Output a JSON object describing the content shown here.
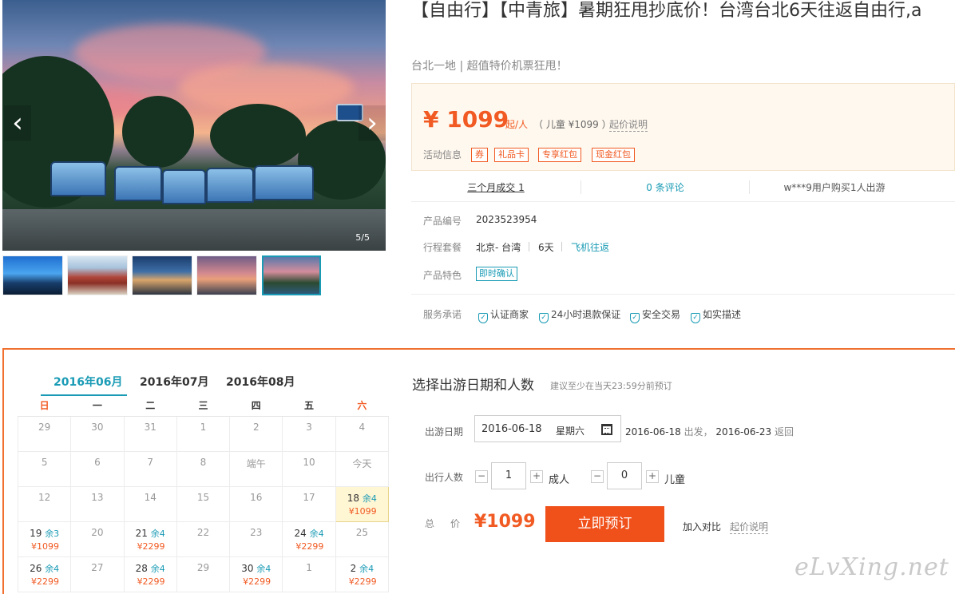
{
  "gallery": {
    "counter": "5/5",
    "prev_icon": "chevron-left-icon",
    "next_icon": "chevron-right-icon",
    "prev_glyph": "‹",
    "next_glyph": "›"
  },
  "product": {
    "title": "【自由行】【中青旅】暑期狂甩抄底价！台湾台北6天往返自由行,a",
    "subtitle": "台北一地 | 超值特价机票狂甩！",
    "price": "¥ 1099",
    "price_unit": "起/人",
    "child_price": "（ 儿童 ¥1099 ）",
    "start_price_note": "起价说明",
    "activity_label": "活动信息",
    "tags": [
      "券",
      "礼品卡",
      "专享红包",
      "现金红包"
    ],
    "stats": [
      "三个月成交 1",
      "0 条评论",
      "w***9用户购买1人出游"
    ],
    "code_label": "产品编号",
    "code_value": "2023523954",
    "package_label": "行程套餐",
    "package_route": "北京- 台湾",
    "package_days": "6天",
    "package_transport": "飞机往返",
    "feature_label": "产品特色",
    "feature_tag": "即时确认",
    "service_label": "服务承诺",
    "services": [
      "认证商家",
      "24小时退款保证",
      "安全交易",
      "如实描述"
    ],
    "accent_color": "#f15a22",
    "link_color": "#1a9bb5"
  },
  "calendar": {
    "months": [
      "2016年06月",
      "2016年07月",
      "2016年08月"
    ],
    "weekdays": [
      "日",
      "一",
      "二",
      "三",
      "四",
      "五",
      "六"
    ],
    "rows": [
      [
        {
          "d": "29"
        },
        {
          "d": "30"
        },
        {
          "d": "31"
        },
        {
          "d": "1"
        },
        {
          "d": "2"
        },
        {
          "d": "3"
        },
        {
          "d": "4"
        }
      ],
      [
        {
          "d": "5"
        },
        {
          "d": "6"
        },
        {
          "d": "7"
        },
        {
          "d": "8"
        },
        {
          "d": "端午"
        },
        {
          "d": "10"
        },
        {
          "d": "今天"
        }
      ],
      [
        {
          "d": "12"
        },
        {
          "d": "13"
        },
        {
          "d": "14"
        },
        {
          "d": "15"
        },
        {
          "d": "16"
        },
        {
          "d": "17"
        },
        {
          "d": "18",
          "rem": "余4",
          "price": "¥1099",
          "sel": true
        }
      ],
      [
        {
          "d": "19",
          "rem": "余3",
          "price": "¥1099"
        },
        {
          "d": "20"
        },
        {
          "d": "21",
          "rem": "余4",
          "price": "¥2299"
        },
        {
          "d": "22"
        },
        {
          "d": "23"
        },
        {
          "d": "24",
          "rem": "余4",
          "price": "¥2299"
        },
        {
          "d": "25"
        }
      ],
      [
        {
          "d": "26",
          "rem": "余4",
          "price": "¥2299"
        },
        {
          "d": "27"
        },
        {
          "d": "28",
          "rem": "余4",
          "price": "¥2299"
        },
        {
          "d": "29"
        },
        {
          "d": "30",
          "rem": "余4",
          "price": "¥2299"
        },
        {
          "d": "1"
        },
        {
          "d": "2",
          "rem": "余4",
          "price": "¥2299"
        }
      ]
    ]
  },
  "booking": {
    "title": "选择出游日期和人数",
    "note": "建议至少在当天23:59分前预订",
    "date_label": "出游日期",
    "date_value": "2016-06-18",
    "weekday_value": "星期六",
    "depart_date": "2016-06-18",
    "depart_word": "出发，",
    "return_date": "2016-06-23",
    "return_word": "返回",
    "people_label": "出行人数",
    "adults": "1",
    "adult_unit": "成人",
    "children": "0",
    "child_unit": "儿童",
    "minus": "−",
    "plus": "+",
    "total_label": "总价",
    "total_value": "¥1099",
    "book_button": "立即预订",
    "compare": "加入对比",
    "start_price_note": "起价说明"
  },
  "watermark": "eLvXing.net"
}
